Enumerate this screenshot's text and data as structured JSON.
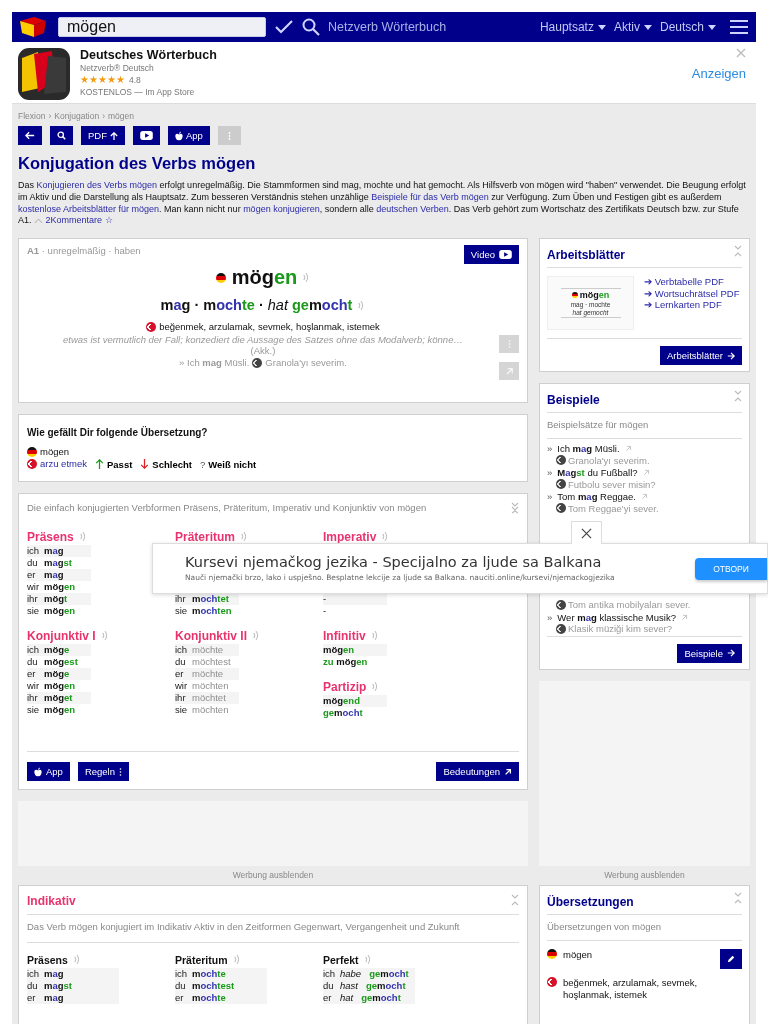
{
  "top_bar": {
    "search_value": "mögen",
    "site_name": "Netzverb Wörterbuch",
    "dropdowns": [
      {
        "label": "Hauptsatz"
      },
      {
        "label": "Aktiv"
      },
      {
        "label": "Deutsch"
      }
    ]
  },
  "app_banner": {
    "name": "Deutsches Wörterbuch",
    "publisher": "Netzverb® Deutsch",
    "stars": 5,
    "rating": "4.8",
    "price": "KOSTENLOS — Im App Store",
    "action": "Anzeigen"
  },
  "breadcrumb": {
    "separator": "›",
    "items": [
      "Flexion",
      "Konjugation",
      "mögen"
    ]
  },
  "toolbar": [
    {
      "kind": "back",
      "disabled": false
    },
    {
      "kind": "search",
      "disabled": false
    },
    {
      "kind": "pdf",
      "label": "PDF",
      "disabled": false
    },
    {
      "kind": "video",
      "disabled": false
    },
    {
      "kind": "app",
      "label": "App",
      "disabled": false
    },
    {
      "kind": "more",
      "disabled": true
    }
  ],
  "title": "Konjugation des Verbs mögen",
  "intro": [
    {
      "text": "Das ",
      "link": false
    },
    {
      "text": "Konjugieren des Verbs mögen",
      "link": true
    },
    {
      "text": " erfolgt unregelmäßig. Die Stammformen sind mag, mochte und hat gemocht. Als Hilfsverb von mögen wird \"haben\" verwendet. Die Beugung erfolgt im Aktiv und die Darstellung als Hauptsatz. Zum besseren Verständnis stehen unzählige ",
      "link": false
    },
    {
      "text": "Beispiele für das Verb mögen",
      "link": true
    },
    {
      "text": " zur Verfügung. Zum Üben und Festigen gibt es außerdem ",
      "link": false
    },
    {
      "text": "kostenlose Arbeitsblätter für mögen",
      "link": true
    },
    {
      "text": ". Man kann nicht nur ",
      "link": false
    },
    {
      "text": "mögen konjugieren",
      "link": true
    },
    {
      "text": ", sondern alle ",
      "link": false
    },
    {
      "text": "deutschen Verben",
      "link": true
    },
    {
      "text": ". Das Verb gehört zum Wortschatz des Zertifikats Deutsch bzw. zur Stufe A1.",
      "link": false
    }
  ],
  "comments": "2Kommentare ☆",
  "verb_card": {
    "meta": "**A1** · unregelmäßig · haben",
    "video": "Video",
    "infinitive": [
      {
        "text": "mög",
        "kind": "stem"
      },
      {
        "text": "en",
        "kind": "ending"
      }
    ],
    "principal_parts": [
      {
        "text": "m",
        "kind": "stem"
      },
      {
        "text": "a",
        "kind": "change"
      },
      {
        "text": "g",
        "kind": "stem"
      },
      {
        "text": " · ",
        "kind": "sep"
      },
      {
        "text": "m",
        "kind": "stem"
      },
      {
        "text": "och",
        "kind": "change"
      },
      {
        "text": "te",
        "kind": "ending"
      },
      {
        "text": " · ",
        "kind": "sep"
      },
      {
        "text": "hat ",
        "kind": "aux"
      },
      {
        "text": "ge",
        "kind": "ending"
      },
      {
        "text": "m",
        "kind": "stem"
      },
      {
        "text": "och",
        "kind": "change"
      },
      {
        "text": "t",
        "kind": "ending"
      }
    ],
    "translations": "beğenmek, arzulamak, sevmek, hoşlanmak, istemek",
    "definition": "etwas ist vermutlich der Fall; konzediert die Aussage des Satzes ohne das Modalverb; könne…",
    "case": "(Akk.)",
    "example": "» Ich **mag** Müsli.",
    "example_translation": "Granola'yı severim."
  },
  "rating": {
    "question": "Wie gefällt Dir folgende Übersetzung?",
    "source": "mögen",
    "target": "arzu etmek",
    "options": [
      {
        "kind": "good",
        "label": "Passt"
      },
      {
        "kind": "bad",
        "label": "Schlecht"
      },
      {
        "kind": "unsure",
        "mark": "?",
        "label": "Weiß nicht"
      }
    ]
  },
  "conjugation": {
    "description": "Die einfach konjugierten Verbformen Präsens, Präteritum, Imperativ und Konjunktiv von mögen",
    "columns": [
      [
        {
          "title": "Präsens",
          "rows": [
            {
              "pronoun": "ich",
              "form": [
                {
                  "text": "m",
                  "kind": "stem"
                },
                {
                  "text": "a",
                  "kind": "change"
                },
                {
                  "text": "g",
                  "kind": "stem"
                }
              ],
              "faded": false
            },
            {
              "pronoun": "du",
              "form": [
                {
                  "text": "m",
                  "kind": "stem"
                },
                {
                  "text": "a",
                  "kind": "change"
                },
                {
                  "text": "g",
                  "kind": "stem"
                },
                {
                  "text": "st",
                  "kind": "ending"
                }
              ],
              "faded": false
            },
            {
              "pronoun": "er",
              "form": [
                {
                  "text": "m",
                  "kind": "stem"
                },
                {
                  "text": "a",
                  "kind": "change"
                },
                {
                  "text": "g",
                  "kind": "stem"
                }
              ],
              "faded": false
            },
            {
              "pronoun": "wir",
              "form": [
                {
                  "text": "mög",
                  "kind": "stem"
                },
                {
                  "text": "en",
                  "kind": "ending"
                }
              ],
              "faded": false
            },
            {
              "pronoun": "ihr",
              "form": [
                {
                  "text": "mög",
                  "kind": "stem"
                },
                {
                  "text": "t",
                  "kind": "ending"
                }
              ],
              "faded": false
            },
            {
              "pronoun": "sie",
              "form": [
                {
                  "text": "mög",
                  "kind": "stem"
                },
                {
                  "text": "en",
                  "kind": "ending"
                }
              ],
              "faded": false
            }
          ]
        },
        {
          "title": "Konjunktiv I",
          "rows": [
            {
              "pronoun": "ich",
              "form": [
                {
                  "text": "mög",
                  "kind": "stem"
                },
                {
                  "text": "e",
                  "kind": "ending"
                }
              ],
              "faded": false
            },
            {
              "pronoun": "du",
              "form": [
                {
                  "text": "mög",
                  "kind": "stem"
                },
                {
                  "text": "est",
                  "kind": "ending"
                }
              ],
              "faded": false
            },
            {
              "pronoun": "er",
              "form": [
                {
                  "text": "mög",
                  "kind": "stem"
                },
                {
                  "text": "e",
                  "kind": "ending"
                }
              ],
              "faded": false
            },
            {
              "pronoun": "wir",
              "form": [
                {
                  "text": "mög",
                  "kind": "stem"
                },
                {
                  "text": "en",
                  "kind": "ending"
                }
              ],
              "faded": false
            },
            {
              "pronoun": "ihr",
              "form": [
                {
                  "text": "mög",
                  "kind": "stem"
                },
                {
                  "text": "et",
                  "kind": "ending"
                }
              ],
              "faded": false
            },
            {
              "pronoun": "sie",
              "form": [
                {
                  "text": "mög",
                  "kind": "stem"
                },
                {
                  "text": "en",
                  "kind": "ending"
                }
              ],
              "faded": false
            }
          ]
        }
      ],
      [
        {
          "title": "Präteritum",
          "rows": [
            {
              "pronoun": "ihr",
              "form": [
                {
                  "text": "m",
                  "kind": "stem"
                },
                {
                  "text": "och",
                  "kind": "change"
                },
                {
                  "text": "tet",
                  "kind": "ending"
                }
              ],
              "faded": false
            },
            {
              "pronoun": "sie",
              "form": [
                {
                  "text": "m",
                  "kind": "stem"
                },
                {
                  "text": "och",
                  "kind": "change"
                },
                {
                  "text": "ten",
                  "kind": "ending"
                }
              ],
              "faded": false
            }
          ]
        },
        {
          "title": "Konjunktiv II",
          "rows": [
            {
              "pronoun": "ich",
              "form": [
                {
                  "text": "möchte",
                  "kind": "stem"
                }
              ],
              "faded": true
            },
            {
              "pronoun": "du",
              "form": [
                {
                  "text": "möchtest",
                  "kind": "stem"
                }
              ],
              "faded": true
            },
            {
              "pronoun": "er",
              "form": [
                {
                  "text": "möchte",
                  "kind": "stem"
                }
              ],
              "faded": true
            },
            {
              "pronoun": "wir",
              "form": [
                {
                  "text": "möchten",
                  "kind": "stem"
                }
              ],
              "faded": true
            },
            {
              "pronoun": "ihr",
              "form": [
                {
                  "text": "möchtet",
                  "kind": "stem"
                }
              ],
              "faded": true
            },
            {
              "pronoun": "sie",
              "form": [
                {
                  "text": "möchten",
                  "kind": "stem"
                }
              ],
              "faded": true
            }
          ]
        }
      ],
      [
        {
          "title": "Imperativ",
          "rows": [
            {
              "form": [
                {
                  "text": "-",
                  "kind": "plain"
                }
              ],
              "faded": false
            },
            {
              "form": [
                {
                  "text": "-",
                  "kind": "plain"
                }
              ],
              "faded": false
            }
          ]
        },
        {
          "title": "Infinitiv",
          "rows": [
            {
              "form": [
                {
                  "text": "mög",
                  "kind": "stem"
                },
                {
                  "text": "en",
                  "kind": "ending"
                }
              ],
              "faded": false
            },
            {
              "form": [
                {
                  "text": "zu ",
                  "kind": "ending"
                },
                {
                  "text": "mög",
                  "kind": "stem"
                },
                {
                  "text": "en",
                  "kind": "ending"
                }
              ],
              "faded": false
            }
          ]
        },
        {
          "title": "Partizip",
          "rows": [
            {
              "form": [
                {
                  "text": "mög",
                  "kind": "stem"
                },
                {
                  "text": "end",
                  "kind": "ending"
                }
              ],
              "faded": false
            },
            {
              "form": [
                {
                  "text": "ge",
                  "kind": "ending"
                },
                {
                  "text": "m",
                  "kind": "stem"
                },
                {
                  "text": "och",
                  "kind": "change"
                },
                {
                  "text": "t",
                  "kind": "ending"
                }
              ],
              "faded": false
            }
          ]
        }
      ]
    ],
    "buttons": [
      {
        "kind": "app",
        "label": "App"
      },
      {
        "kind": "rules",
        "label": "Regeln"
      },
      {
        "kind": "meanings",
        "label": "Bedeutungen"
      }
    ]
  },
  "left_ad": {
    "hide_label": "Werbung ausblenden"
  },
  "indicative": {
    "title": "Indikativ",
    "description": "Das Verb mögen konjugiert im Indikativ Aktiv in den Zeitformen Gegenwart, Vergangenheit und Zukunft",
    "blocks": [
      {
        "title": "Präsens",
        "rows": [
          {
            "pronoun": "ich",
            "form": [
              {
                "text": "m",
                "kind": "stem"
              },
              {
                "text": "a",
                "kind": "change"
              },
              {
                "text": "g",
                "kind": "stem"
              }
            ]
          },
          {
            "pronoun": "du",
            "form": [
              {
                "text": "m",
                "kind": "stem"
              },
              {
                "text": "a",
                "kind": "change"
              },
              {
                "text": "g",
                "kind": "stem"
              },
              {
                "text": "st",
                "kind": "ending"
              }
            ]
          },
          {
            "pronoun": "er",
            "form": [
              {
                "text": "m",
                "kind": "stem"
              },
              {
                "text": "a",
                "kind": "change"
              },
              {
                "text": "g",
                "kind": "stem"
              }
            ]
          }
        ]
      },
      {
        "title": "Präteritum",
        "rows": [
          {
            "pronoun": "ich",
            "form": [
              {
                "text": "m",
                "kind": "stem"
              },
              {
                "text": "och",
                "kind": "change"
              },
              {
                "text": "te",
                "kind": "ending"
              }
            ]
          },
          {
            "pronoun": "du",
            "form": [
              {
                "text": "m",
                "kind": "stem"
              },
              {
                "text": "och",
                "kind": "change"
              },
              {
                "text": "test",
                "kind": "ending"
              }
            ]
          },
          {
            "pronoun": "er",
            "form": [
              {
                "text": "m",
                "kind": "stem"
              },
              {
                "text": "och",
                "kind": "change"
              },
              {
                "text": "te",
                "kind": "ending"
              }
            ]
          }
        ]
      },
      {
        "title": "Perfekt",
        "rows": [
          {
            "pronoun": "ich",
            "form": [
              {
                "text": "habe",
                "kind": "aux"
              },
              {
                "text": "ge",
                "kind": "ending"
              },
              {
                "text": "m",
                "kind": "stem"
              },
              {
                "text": "och",
                "kind": "change"
              },
              {
                "text": "t",
                "kind": "ending"
              }
            ]
          },
          {
            "pronoun": "du",
            "form": [
              {
                "text": "hast",
                "kind": "aux"
              },
              {
                "text": "ge",
                "kind": "ending"
              },
              {
                "text": "m",
                "kind": "stem"
              },
              {
                "text": "och",
                "kind": "change"
              },
              {
                "text": "t",
                "kind": "ending"
              }
            ]
          },
          {
            "pronoun": "er",
            "form": [
              {
                "text": "hat",
                "kind": "aux"
              },
              {
                "text": "ge",
                "kind": "ending"
              },
              {
                "text": "m",
                "kind": "stem"
              },
              {
                "text": "och",
                "kind": "change"
              },
              {
                "text": "t",
                "kind": "ending"
              }
            ]
          }
        ]
      }
    ]
  },
  "worksheets": {
    "title": "Arbeitsblätter",
    "preview": {
      "verb": [
        {
          "text": "mög",
          "kind": "stem"
        },
        {
          "text": "en",
          "kind": "ending"
        }
      ],
      "forms": "mag · mochte",
      "participle": "hat gemocht"
    },
    "links": [
      "➔ Verbtabelle PDF",
      "➔ Wortsuchrätsel PDF",
      "➔ Lernkarten PDF"
    ],
    "button": "Arbeitsblätter"
  },
  "examples": {
    "title": "Beispiele",
    "subtitle": "Beispielsätze für mögen",
    "items": [
      {
        "bullet": "»",
        "sentence": [
          {
            "text": "Ich ",
            "kind": "plain"
          },
          {
            "text": "m",
            "kind": "stem"
          },
          {
            "text": "a",
            "kind": "change"
          },
          {
            "text": "g",
            "kind": "stem"
          },
          {
            "text": " Müsli.",
            "kind": "plain"
          }
        ],
        "translation": "Granola'yı severim."
      },
      {
        "bullet": "»",
        "sentence": [
          {
            "text": "M",
            "kind": "stem"
          },
          {
            "text": "a",
            "kind": "change"
          },
          {
            "text": "g",
            "kind": "stem"
          },
          {
            "text": "st",
            "kind": "ending"
          },
          {
            "text": " du Fußball?",
            "kind": "plain"
          }
        ],
        "translation": "Futbolu sever misin?"
      },
      {
        "bullet": "»",
        "sentence": [
          {
            "text": "Tom ",
            "kind": "plain"
          },
          {
            "text": "m",
            "kind": "stem"
          },
          {
            "text": "a",
            "kind": "change"
          },
          {
            "text": "g",
            "kind": "stem"
          },
          {
            "text": " Reggae.",
            "kind": "plain"
          }
        ],
        "translation": "Tom Reggae'yi sever."
      },
      {
        "translation": "Tom antika mobilyaları sever."
      },
      {
        "bullet": "»",
        "sentence": [
          {
            "text": "Wer ",
            "kind": "plain"
          },
          {
            "text": "m",
            "kind": "stem"
          },
          {
            "text": "a",
            "kind": "change"
          },
          {
            "text": "g",
            "kind": "stem"
          },
          {
            "text": " klassische Musik?",
            "kind": "plain"
          }
        ],
        "translation": "Klasik müziği kim sever?"
      }
    ],
    "button": "Beispiele"
  },
  "right_ad": {
    "hide_label": "Werbung ausblenden"
  },
  "translations": {
    "title": "Übersetzungen",
    "subtitle": "Übersetzungen von mögen",
    "rows": [
      {
        "kind": "de",
        "text": "mögen",
        "editable": true
      },
      {
        "kind": "tr",
        "text": "beğenmek, arzulamak, sevmek, hoşlanmak, istemek",
        "editable": false
      }
    ]
  },
  "ad_overlay": {
    "title": "Kursevi njemačkog jezika - Specijalno za ljude sa Balkana",
    "description": "Nauči njemački brzo, lako i uspješno. Besplatne lekcije za ljude sa Balkana. nauciti.online/kursevi/njemackogjezika",
    "button": "ОТВОРИ"
  }
}
